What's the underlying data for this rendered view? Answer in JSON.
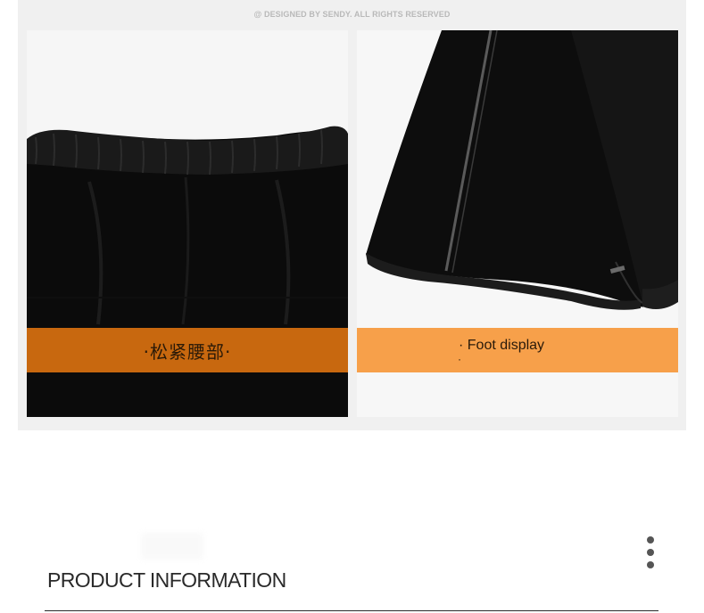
{
  "gallery": {
    "copyright": "@ DESIGNED BY SENDY. ALL RIGHTS RESERVED",
    "cards": [
      {
        "caption": "·松紧腰部·",
        "photo": "black-pants-elastic-waistband",
        "band_color": "#c8680f"
      },
      {
        "caption": "· Foot display",
        "caption_tail": "·",
        "photo": "black-pants-leg-hem",
        "band_color": "#f7a04a"
      }
    ]
  },
  "product_info": {
    "title": "PRODUCT INFORMATION",
    "menu_icon": "more-vertical-icon"
  }
}
